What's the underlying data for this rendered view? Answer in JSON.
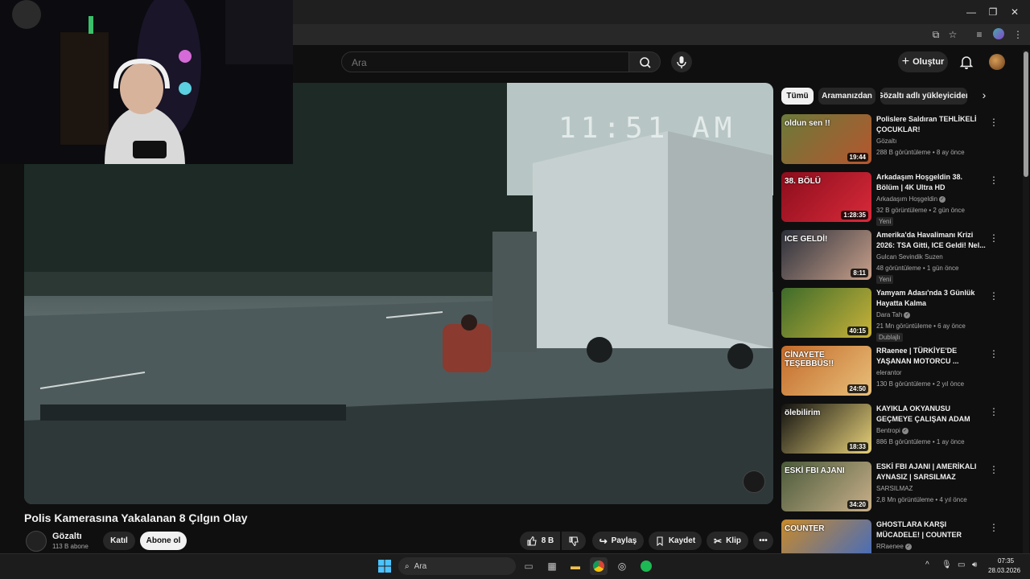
{
  "youtube": {
    "search_placeholder": "Ara",
    "create_label": "Oluştur"
  },
  "video": {
    "clock_overlay": "11:51 AM",
    "title": "Polis Kamerasına Yakalanan 8 Çılgın Olay",
    "channel": "Gözaltı",
    "subscribers": "113 B abone",
    "join_label": "Katıl",
    "subscribe_label": "Abone ol",
    "like_count": "8 B",
    "share_label": "Paylaş",
    "save_label": "Kaydet",
    "clip_label": "Klip"
  },
  "chips": [
    "Tümü",
    "Aramanızdan",
    "Gözaltı adlı yükleyiciden"
  ],
  "recommendations": [
    {
      "title": "Polislere Saldıran TEHLİKELİ ÇOCUKLAR!",
      "channel": "Gözaltı",
      "verified": false,
      "meta": "288 B görüntüleme • 8 ay önce",
      "duration": "19:44",
      "badge": "",
      "thumb_colors": [
        "#6b7a3a",
        "#b5562e"
      ],
      "thumb_text": "oldun sen !!"
    },
    {
      "title": "Arkadaşım Hoşgeldin 38. Bölüm | 4K Ultra HD",
      "channel": "Arkadaşım Hoşgeldin",
      "verified": true,
      "meta": "32 B görüntüleme • 2 gün önce",
      "duration": "1:28:35",
      "badge": "Yeni",
      "thumb_colors": [
        "#8b0d1c",
        "#d92a3a"
      ],
      "thumb_text": "38. BÖLÜ"
    },
    {
      "title": "Amerika'da Havalimanı Krizi 2026: TSA Gitti, ICE Geldi! Nel...",
      "channel": "Gulcan Sevindik Suzen",
      "verified": false,
      "meta": "48 gör­üntüleme • 1 gün önce",
      "duration": "8:11",
      "badge": "Yeni",
      "thumb_colors": [
        "#2a2f3a",
        "#c9a08a"
      ],
      "thumb_text": "ICE GELDİ!"
    },
    {
      "title": "Yamyam Adası'nda 3 Günlük Hayatta Kalma",
      "channel": "Dara Tah",
      "verified": true,
      "meta": "21 Mn görüntüleme • 6 ay önce",
      "duration": "40:15",
      "badge": "Dublajlı",
      "thumb_colors": [
        "#3d6b2a",
        "#c9b23a"
      ],
      "thumb_text": ""
    },
    {
      "title": "RRaenee | TÜRKİYE'DE YAŞANAN MOTORCU ...",
      "channel": "elerantor",
      "verified": false,
      "meta": "130 B görüntüleme • 2 yıl önce",
      "duration": "24:50",
      "badge": "",
      "thumb_colors": [
        "#c46a2a",
        "#e8c07a"
      ],
      "thumb_text": "CİNAYETE TEŞEBBÜS!!"
    },
    {
      "title": "KAYIKLA OKYANUSU GEÇMEYE ÇALIŞAN ADAM",
      "channel": "Bentropi",
      "verified": true,
      "meta": "886 B görüntüleme • 1 ay önce",
      "duration": "18:33",
      "badge": "",
      "thumb_colors": [
        "#111111",
        "#e8d27a"
      ],
      "thumb_text": "ölebilirim"
    },
    {
      "title": "ESKİ FBI AJANI | AMERİKALI AYNASIZ | SARSILMAZ",
      "channel": "SARSILMAZ",
      "verified": false,
      "meta": "2,8 Mn görüntüleme • 4 yıl önce",
      "duration": "34:20",
      "badge": "",
      "thumb_colors": [
        "#4a5a3a",
        "#c9b08a"
      ],
      "thumb_text": "ESKİ FBI AJANI"
    },
    {
      "title": "GHOSTLARA KARŞI MÜCADELE! | COUNTER STRIK...",
      "channel": "RRaenee",
      "verified": true,
      "meta": "305 B görüntüleme • 4 gün önce",
      "duration": "",
      "badge": "",
      "thumb_colors": [
        "#c98a2a",
        "#3a6ac9"
      ],
      "thumb_text": "COUNTER"
    }
  ],
  "taskbar": {
    "search_label": "Ara",
    "time": "07:35",
    "date": "28.03.2026"
  }
}
